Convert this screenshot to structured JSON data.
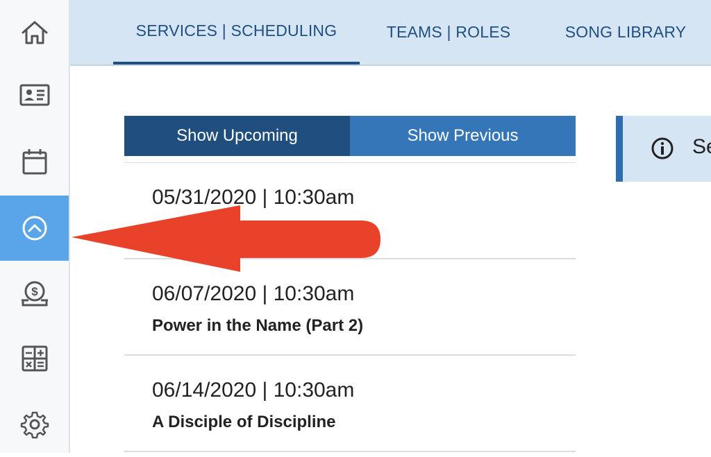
{
  "sidebar": {
    "items": [
      {
        "icon": "home-icon"
      },
      {
        "icon": "contact-card-icon"
      },
      {
        "icon": "calendar-icon"
      },
      {
        "icon": "chevron-up-circle-icon",
        "active": true
      },
      {
        "icon": "donation-icon"
      },
      {
        "icon": "calculator-icon"
      },
      {
        "icon": "gear-icon"
      }
    ]
  },
  "tabs": [
    {
      "label": "SERVICES | SCHEDULING",
      "active": true
    },
    {
      "label": "TEAMS | ROLES"
    },
    {
      "label": "SONG LIBRARY"
    }
  ],
  "toggle": {
    "upcoming": "Show Upcoming",
    "previous": "Show Previous"
  },
  "services": [
    {
      "datetime": "05/31/2020 | 10:30am",
      "name": ""
    },
    {
      "datetime": "06/07/2020 | 10:30am",
      "name": "Power in the Name (Part 2)"
    },
    {
      "datetime": "06/14/2020 | 10:30am",
      "name": "A Disciple of Discipline"
    }
  ],
  "info": {
    "text": "Se"
  },
  "colors": {
    "accent": "#1f4e7f",
    "active_sidebar": "#5aa5ea",
    "annotation_arrow": "#e8432a"
  }
}
